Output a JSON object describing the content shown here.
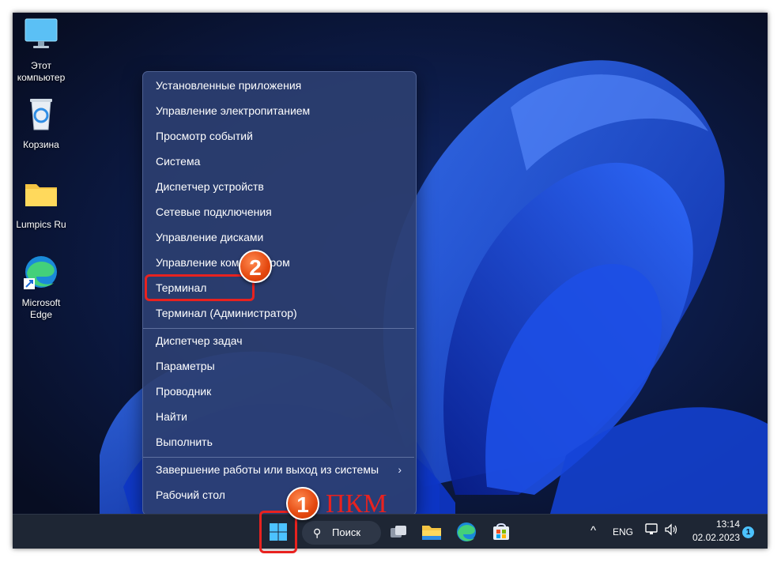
{
  "desktop": {
    "icons": [
      {
        "label": "Этот компьютер",
        "icon": "monitor-icon"
      },
      {
        "label": "Корзина",
        "icon": "recycle-bin-icon"
      },
      {
        "label": "Lumpics Ru",
        "icon": "folder-icon"
      },
      {
        "label": "Microsoft Edge",
        "icon": "edge-icon"
      }
    ]
  },
  "context_menu": {
    "items": [
      {
        "label": "Установленные приложения"
      },
      {
        "label": "Управление электропитанием"
      },
      {
        "label": "Просмотр событий"
      },
      {
        "label": "Система"
      },
      {
        "label": "Диспетчер устройств"
      },
      {
        "label": "Сетевые подключения"
      },
      {
        "label": "Управление дисками"
      },
      {
        "label": "Управление компьютером"
      },
      {
        "label": "Терминал"
      },
      {
        "label": "Терминал (Администратор)"
      },
      {
        "label": "Диспетчер задач"
      },
      {
        "label": "Параметры"
      },
      {
        "label": "Проводник"
      },
      {
        "label": "Найти"
      },
      {
        "label": "Выполнить"
      },
      {
        "label": "Завершение работы или выход из системы",
        "submenu_arrow": "›"
      },
      {
        "label": "Рабочий стол"
      }
    ]
  },
  "taskbar": {
    "search_label": "Поиск",
    "apps": [
      "start-icon",
      "task-view-icon",
      "file-explorer-icon",
      "edge-icon",
      "store-icon"
    ],
    "tray": {
      "chevron": "^",
      "language": "ENG",
      "time": "13:14",
      "date": "02.02.2023",
      "notification_count": "1"
    }
  },
  "annotations": {
    "step1": "1",
    "step2": "2",
    "step1_caption": "ПКМ",
    "highlight_color": "#e8221f",
    "badge_color": "#e4480f"
  }
}
